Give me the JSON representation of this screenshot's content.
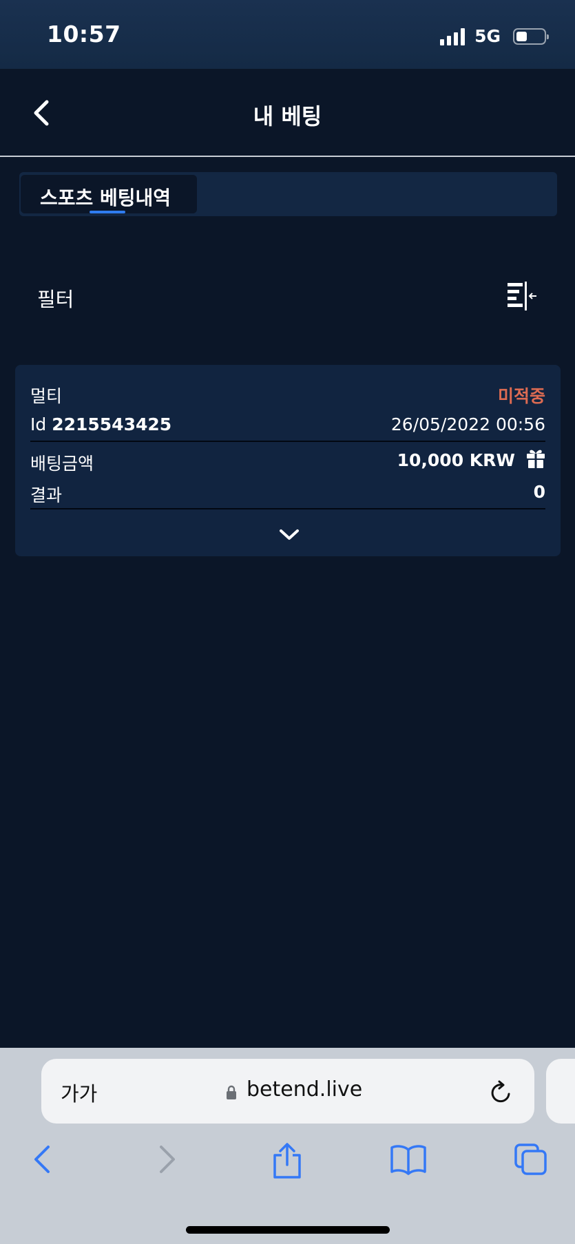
{
  "status_bar": {
    "time": "10:57",
    "network": "5G",
    "battery_level": 0.3
  },
  "header": {
    "title": "내 베팅",
    "back_icon": "chevron-left-icon"
  },
  "tabs": [
    {
      "label": "스포츠 베팅내역",
      "active": true
    }
  ],
  "filter": {
    "label": "필터",
    "icon": "filter-collapse-icon"
  },
  "bets": [
    {
      "type": "멀티",
      "status": "미적중",
      "id_label": "Id",
      "id_value": "2215543425",
      "datetime": "26/05/2022 00:56",
      "stake_label": "배팅금액",
      "stake_value": "10,000 KRW",
      "stake_icon": "gift-icon",
      "result_label": "결과",
      "result_value": "0",
      "expand_icon": "chevron-down-icon"
    }
  ],
  "browser": {
    "text_size_label": "가가",
    "url": "betend.live",
    "nav": [
      "back-icon",
      "forward-icon",
      "share-icon",
      "bookmarks-icon",
      "tabs-icon"
    ]
  },
  "colors": {
    "background": "#0b1628",
    "card": "#112440",
    "accent": "#2f7cf0",
    "status_lost": "#dd6b52",
    "browser_chrome": "#c7cdd5",
    "browser_link": "#3478f6"
  }
}
